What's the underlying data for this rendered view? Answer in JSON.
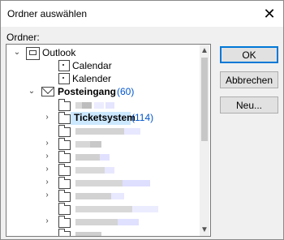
{
  "window": {
    "title": "Ordner auswählen",
    "close_glyph": "✕",
    "folder_label": "Ordner:"
  },
  "tree": {
    "items": [
      {
        "label": "Outlook",
        "icon": "outlook-root-icon",
        "expand": "⌄"
      },
      {
        "label": "Calendar",
        "icon": "calendar-icon"
      },
      {
        "label": "Kalender",
        "icon": "calendar-icon"
      },
      {
        "label": "Posteingang",
        "count": "(60)",
        "icon": "mail-icon",
        "expand": "⌄"
      },
      {
        "label": "Ticketsystem",
        "count": "(114)",
        "icon": "folder-icon",
        "expand": "›",
        "selected": true
      }
    ]
  },
  "scrollbar": {
    "up_glyph": "▲",
    "down_glyph": "▼"
  },
  "buttons": {
    "ok": "OK",
    "cancel": "Abbrechen",
    "new": "Neu..."
  }
}
